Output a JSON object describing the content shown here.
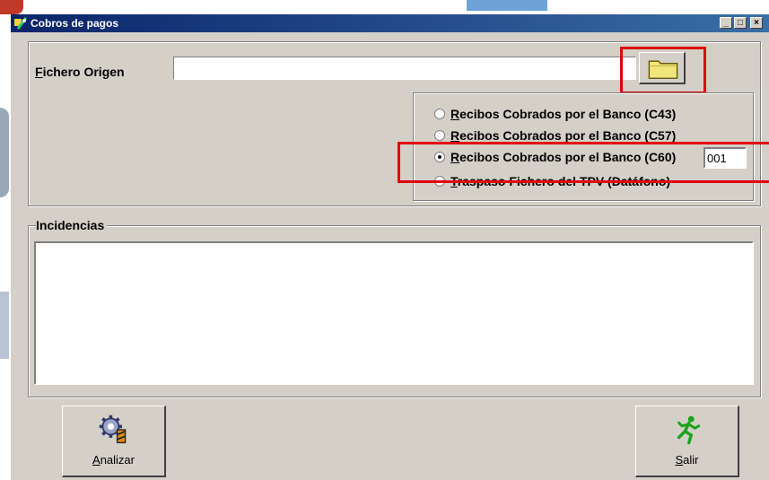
{
  "window": {
    "title": "Cobros de pagos",
    "controls": {
      "minimize": "_",
      "maximize": "□",
      "close": "×"
    }
  },
  "source_file": {
    "label": "Fichero Origen",
    "value": "",
    "browse_icon": "folder-icon"
  },
  "options": [
    {
      "label": "Recibos Cobrados por el Banco (C43)",
      "selected": false
    },
    {
      "label": "Recibos Cobrados por el Banco (C57)",
      "selected": false
    },
    {
      "label": "Recibos Cobrados por el Banco (C60)",
      "selected": true
    },
    {
      "label": "Traspaso Fichero del TPV (Datáfono)",
      "selected": false
    }
  ],
  "c60_code": "001",
  "incidencias": {
    "label": "Incidencias",
    "content": ""
  },
  "buttons": {
    "analyze": {
      "label": "Analizar",
      "icon": "gear-icon"
    },
    "exit": {
      "label": "Salir",
      "icon": "running-man-icon"
    }
  },
  "colors": {
    "titlebar": "#0a246a",
    "face": "#d4d0c8",
    "highlight": "#e00000"
  }
}
